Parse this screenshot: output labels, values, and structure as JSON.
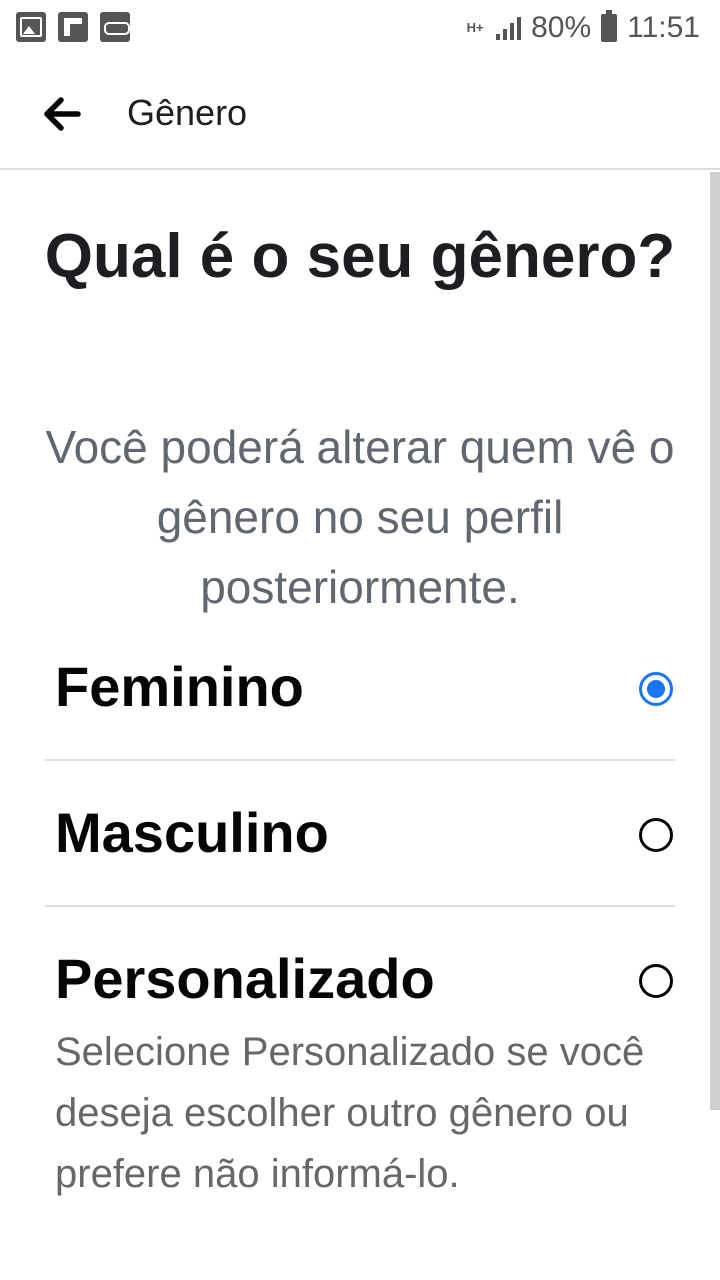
{
  "status_bar": {
    "left_icons": [
      "gallery-icon",
      "flipboard-icon",
      "voicemail-icon"
    ],
    "network_type": "H+",
    "battery_percent": "80%",
    "time": "11:51"
  },
  "app_bar": {
    "title": "Gênero"
  },
  "page": {
    "headline": "Qual é o seu gênero?",
    "subtitle": "Você poderá alterar quem vê o gênero no seu perfil posteriormente."
  },
  "options": [
    {
      "label": "Feminino",
      "selected": true
    },
    {
      "label": "Masculino",
      "selected": false
    },
    {
      "label": "Personalizado",
      "selected": false,
      "description": "Selecione Personalizado se você deseja escolher outro gênero ou prefere não informá-lo."
    }
  ],
  "colors": {
    "accent": "#1877f2",
    "text_primary": "#1c1e21",
    "text_secondary": "#606770",
    "divider": "#dadde1"
  }
}
